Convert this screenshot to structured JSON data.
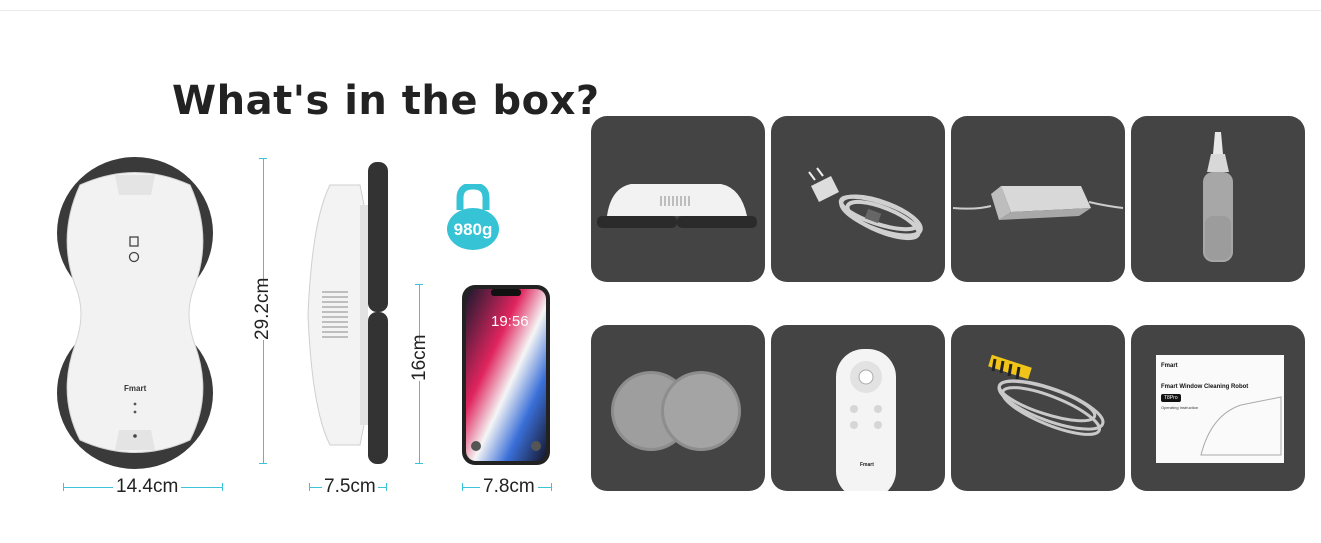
{
  "page": {
    "title": "What's in the box?"
  },
  "dimensions": {
    "robot_width": "14.4cm",
    "robot_height": "29.2cm",
    "side_width": "7.5cm",
    "side_height": "16cm",
    "phone_width": "7.8cm"
  },
  "weight": {
    "value": "980g",
    "color": "#36c3d6"
  },
  "brand": "Fmart",
  "phone": {
    "time": "19:56"
  },
  "manual": {
    "brand": "Fmart",
    "title": "Fmart Window Cleaning Robot",
    "model": "T8Pro",
    "subtitle": "Operating Instruction"
  },
  "box_items": [
    {
      "icon": "robot-side-icon"
    },
    {
      "icon": "power-cord-icon"
    },
    {
      "icon": "power-adapter-icon"
    },
    {
      "icon": "water-bottle-icon"
    },
    {
      "icon": "cleaning-pads-icon"
    },
    {
      "icon": "remote-control-icon"
    },
    {
      "icon": "safety-rope-icon"
    },
    {
      "icon": "manual-icon"
    }
  ],
  "colors": {
    "accent": "#36c3d6",
    "tile": "#444444"
  }
}
